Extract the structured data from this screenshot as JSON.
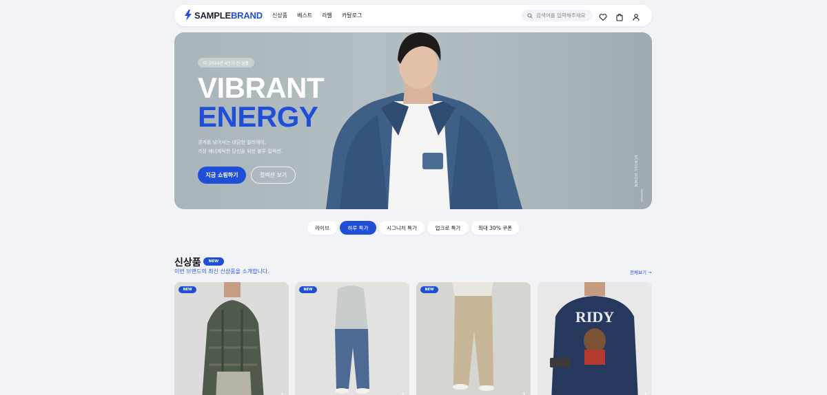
{
  "header": {
    "logo": {
      "prefix": "SAMPLE",
      "suffix": "BRAND",
      "icon": "bolt-icon"
    },
    "nav": [
      "신상품",
      "베스트",
      "라벨",
      "카탈로그"
    ],
    "search_placeholder": "검색어를 입력해주세요",
    "icons": [
      "heart-icon",
      "bag-icon",
      "user-icon"
    ]
  },
  "hero": {
    "badge": "2024년 4분기 신 상품",
    "title_line1": "VIBRANT",
    "title_line2": "ENERGY",
    "desc_line1": "경계를 넘어서는 대담한 컬러웨이,",
    "desc_line2": "가장 에너제틱한 당신을 위한 볼루 컬렉션.",
    "primary_button": "지금 쇼핑하기",
    "secondary_button": "컬렉션 보기",
    "scroll_label": "SCROLL DOWN"
  },
  "tabs": [
    {
      "label": "라이브",
      "active": false
    },
    {
      "label": "하루 특가",
      "active": true
    },
    {
      "label": "시그니처 특가",
      "active": false
    },
    {
      "label": "업크로 특가",
      "active": false
    },
    {
      "label": "최대 30% 쿠폰",
      "active": false
    }
  ],
  "section": {
    "title": "신상품",
    "chip": "NEW",
    "subtitle": "이번 브랜드의 최신 신상품을 소개합니다.",
    "see_all": "전체보기 →"
  },
  "products": [
    {
      "badge": "NEW"
    },
    {
      "badge": "NEW"
    },
    {
      "badge": "NEW"
    },
    {
      "badge": ""
    }
  ],
  "colors": {
    "accent": "#1f4fd6",
    "bg": "#f1f3f7"
  }
}
